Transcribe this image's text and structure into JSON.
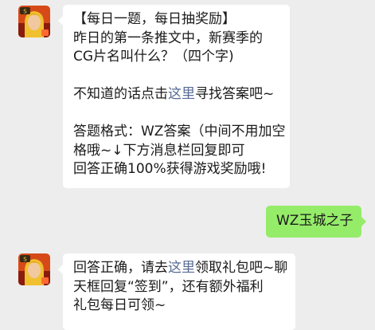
{
  "conversation": {
    "msg1": {
      "lines": [
        "【每日一题，每日抽奖励】",
        "昨日的第一条推文中，新赛季的",
        "CG片名叫什么？（四个字)"
      ],
      "hint_prefix": "不知道的话点击",
      "hint_link": "这里",
      "hint_suffix": "寻找答案吧~",
      "format_lines": [
        "答题格式：WZ答案（中间不用加空",
        "格哦~↓下方消息栏回复即可",
        "回答正确100%获得游戏奖励哦!"
      ]
    },
    "msg2": {
      "text": "WZ玉城之子"
    },
    "msg3": {
      "prefix": "回答正确，请去",
      "link": "这里",
      "suffix": "领取礼包吧~聊",
      "lines": [
        "天框回复“签到”，还有额外福利",
        "礼包每日可领~"
      ]
    }
  },
  "colors": {
    "background": "#ededed",
    "incoming_bubble": "#ffffff",
    "outgoing_bubble": "#95ec69",
    "link": "#576b95"
  },
  "icons": {
    "sender_avatar": "game-hero-avatar-icon"
  }
}
